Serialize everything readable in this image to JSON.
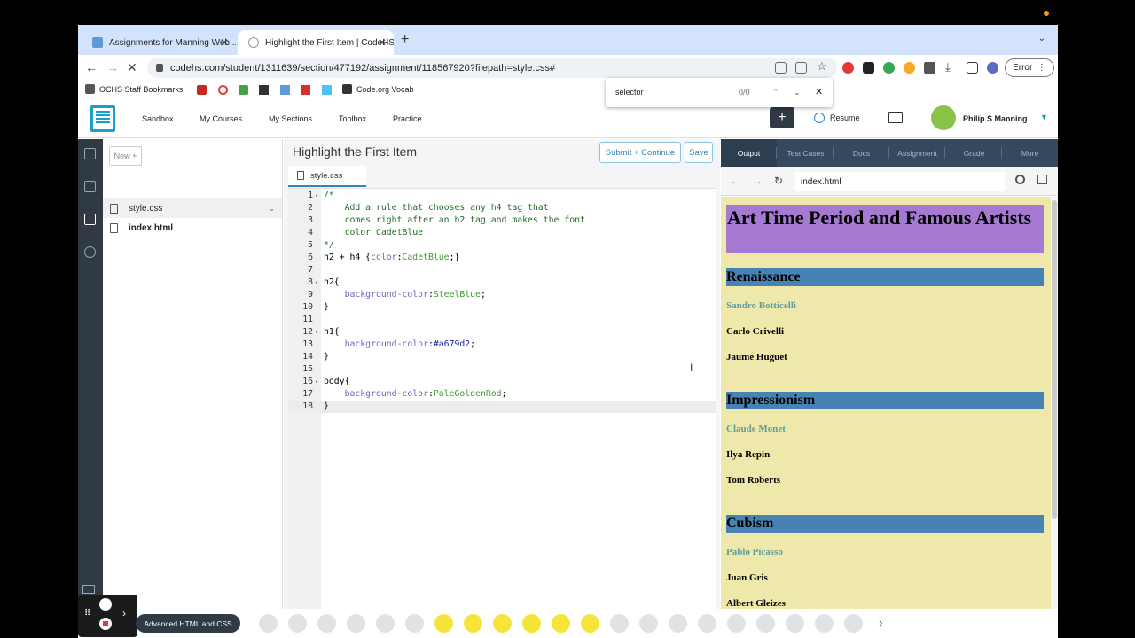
{
  "browser": {
    "tabs": [
      {
        "label": "Assignments for Manning Web...",
        "active": false
      },
      {
        "label": "Highlight the First Item | CodeHS",
        "active": true
      }
    ],
    "url": "codehs.com/student/1311639/section/477192/assignment/118567920?filepath=style.css#",
    "error_label": "Error",
    "bookmarks": [
      {
        "label": "OCHS Staff Bookmarks"
      },
      {
        "label": "Code.org Vocab"
      }
    ],
    "find": {
      "query": "selector",
      "count": "0/0"
    }
  },
  "header": {
    "nav": [
      "Sandbox",
      "My Courses",
      "My Sections",
      "Toolbox",
      "Practice"
    ],
    "plus_label": "+",
    "resume_label": "Resume",
    "user_name": "Philip S Manning"
  },
  "files": {
    "new_label": "New +",
    "items": [
      {
        "name": "style.css",
        "active": true
      },
      {
        "name": "index.html",
        "active": false
      }
    ]
  },
  "editor": {
    "title": "Highlight the First Item",
    "submit_label": "Submit + Continue",
    "save_label": "Save",
    "tab_label": "style.css",
    "lines": [
      {
        "n": "1",
        "fold": true,
        "text": "/*"
      },
      {
        "n": "2",
        "fold": false,
        "text": "    Add a rule that chooses any h4 tag that"
      },
      {
        "n": "3",
        "fold": false,
        "text": "    comes right after an h2 tag and makes the font"
      },
      {
        "n": "4",
        "fold": false,
        "text": "    color CadetBlue"
      },
      {
        "n": "5",
        "fold": false,
        "text": "*/"
      },
      {
        "n": "6",
        "fold": false,
        "text": "h2 + h4 {color:CadetBlue;}"
      },
      {
        "n": "7",
        "fold": false,
        "text": ""
      },
      {
        "n": "8",
        "fold": true,
        "text": "h2{"
      },
      {
        "n": "9",
        "fold": false,
        "text": "    background-color:SteelBlue;"
      },
      {
        "n": "10",
        "fold": false,
        "text": "}"
      },
      {
        "n": "11",
        "fold": false,
        "text": ""
      },
      {
        "n": "12",
        "fold": true,
        "text": "h1{"
      },
      {
        "n": "13",
        "fold": false,
        "text": "    background-color:#a679d2;"
      },
      {
        "n": "14",
        "fold": false,
        "text": "}"
      },
      {
        "n": "15",
        "fold": false,
        "text": ""
      },
      {
        "n": "16",
        "fold": true,
        "text": "body{"
      },
      {
        "n": "17",
        "fold": false,
        "text": "    background-color:PaleGoldenRod;"
      },
      {
        "n": "18",
        "fold": false,
        "text": "}"
      }
    ],
    "current_line": "18"
  },
  "right_panel": {
    "tabs": [
      "Output",
      "Test Cases",
      "Docs",
      "Assignment",
      "Grade",
      "More"
    ],
    "active_tab": "Output",
    "preview_url": "index.html",
    "page": {
      "h1": "Art Time Period and Famous Artists",
      "sections": [
        {
          "h2": "Renaissance",
          "artists": [
            "Sandro Botticelli",
            "Carlo Crivelli",
            "Jaume Huguet"
          ]
        },
        {
          "h2": "Impressionism",
          "artists": [
            "Claude Monet",
            "Ilya Repin",
            "Tom Roberts"
          ]
        },
        {
          "h2": "Cubism",
          "artists": [
            "Pablo Picasso",
            "Juan Gris",
            "Albert Gleizes"
          ]
        }
      ]
    },
    "colors": {
      "body": "#eee8aa",
      "h1": "#a679d2",
      "h2": "#4682b4",
      "first_h4": "#5f9ea0"
    }
  },
  "bottom": {
    "lesson_label": "Advanced HTML and CSS"
  }
}
